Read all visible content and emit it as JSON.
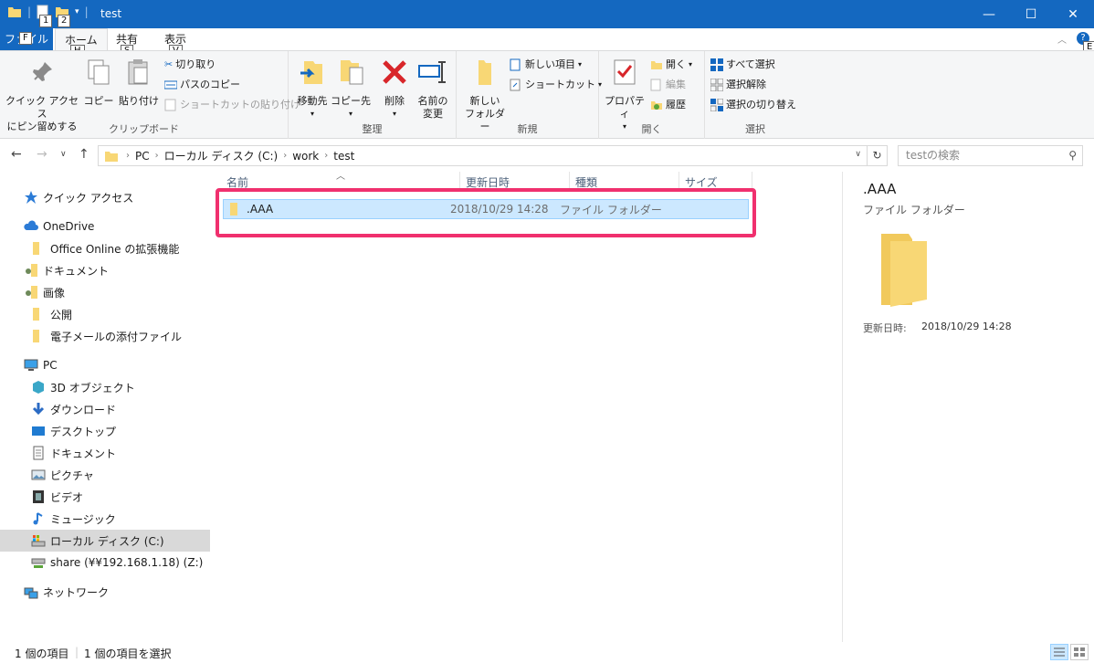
{
  "window": {
    "title": "test"
  },
  "keytips": {
    "qat1": "1",
    "qat2": "2",
    "file": "F",
    "home": "H",
    "share": "S",
    "view": "V",
    "help": "E"
  },
  "tabs": {
    "file": "ファイル",
    "home": "ホーム",
    "share": "共有",
    "view": "表示"
  },
  "ribbon": {
    "clipboard": {
      "label": "クリップボード",
      "pin": "クイック アクセス\nにピン留めする",
      "copy": "コピー",
      "paste": "貼り付け",
      "cut": "切り取り",
      "copy_path": "パスのコピー",
      "paste_shortcut": "ショートカットの貼り付け"
    },
    "organize": {
      "label": "整理",
      "move_to": "移動先",
      "copy_to": "コピー先",
      "delete": "削除",
      "rename": "名前の\n変更"
    },
    "new": {
      "label": "新規",
      "new_folder": "新しい\nフォルダー",
      "new_item": "新しい項目",
      "easy_access": "ショートカット"
    },
    "open": {
      "label": "開く",
      "properties": "プロパティ",
      "open": "開く",
      "edit": "編集",
      "history": "履歴"
    },
    "select": {
      "label": "選択",
      "select_all": "すべて選択",
      "select_none": "選択解除",
      "invert": "選択の切り替え"
    }
  },
  "address": {
    "crumbs": [
      "PC",
      "ローカル ディスク (C:)",
      "work",
      "test"
    ],
    "search_placeholder": "testの検索"
  },
  "nav": {
    "quick_access": "クイック アクセス",
    "onedrive": "OneDrive",
    "onedrive_items": [
      "Office Online の拡張機能",
      "ドキュメント",
      "画像",
      "公開",
      "電子メールの添付ファイル"
    ],
    "pc": "PC",
    "pc_items": [
      "3D オブジェクト",
      "ダウンロード",
      "デスクトップ",
      "ドキュメント",
      "ピクチャ",
      "ビデオ",
      "ミュージック",
      "ローカル ディスク (C:)",
      "share (¥¥192.168.1.18) (Z:)"
    ],
    "network": "ネットワーク"
  },
  "columns": {
    "name": "名前",
    "date": "更新日時",
    "type": "種類",
    "size": "サイズ"
  },
  "files": [
    {
      "name": ".AAA",
      "date": "2018/10/29 14:28",
      "type": "ファイル フォルダー"
    }
  ],
  "details": {
    "name": ".AAA",
    "type": "ファイル フォルダー",
    "date_label": "更新日時:",
    "date": "2018/10/29 14:28"
  },
  "status": {
    "count": "1 個の項目",
    "selected": "1 個の項目を選択"
  },
  "colors": {
    "accent": "#1468c0",
    "selection": "#cce8ff",
    "highlight_border": "#f0306e",
    "folder": "#f8d775"
  }
}
